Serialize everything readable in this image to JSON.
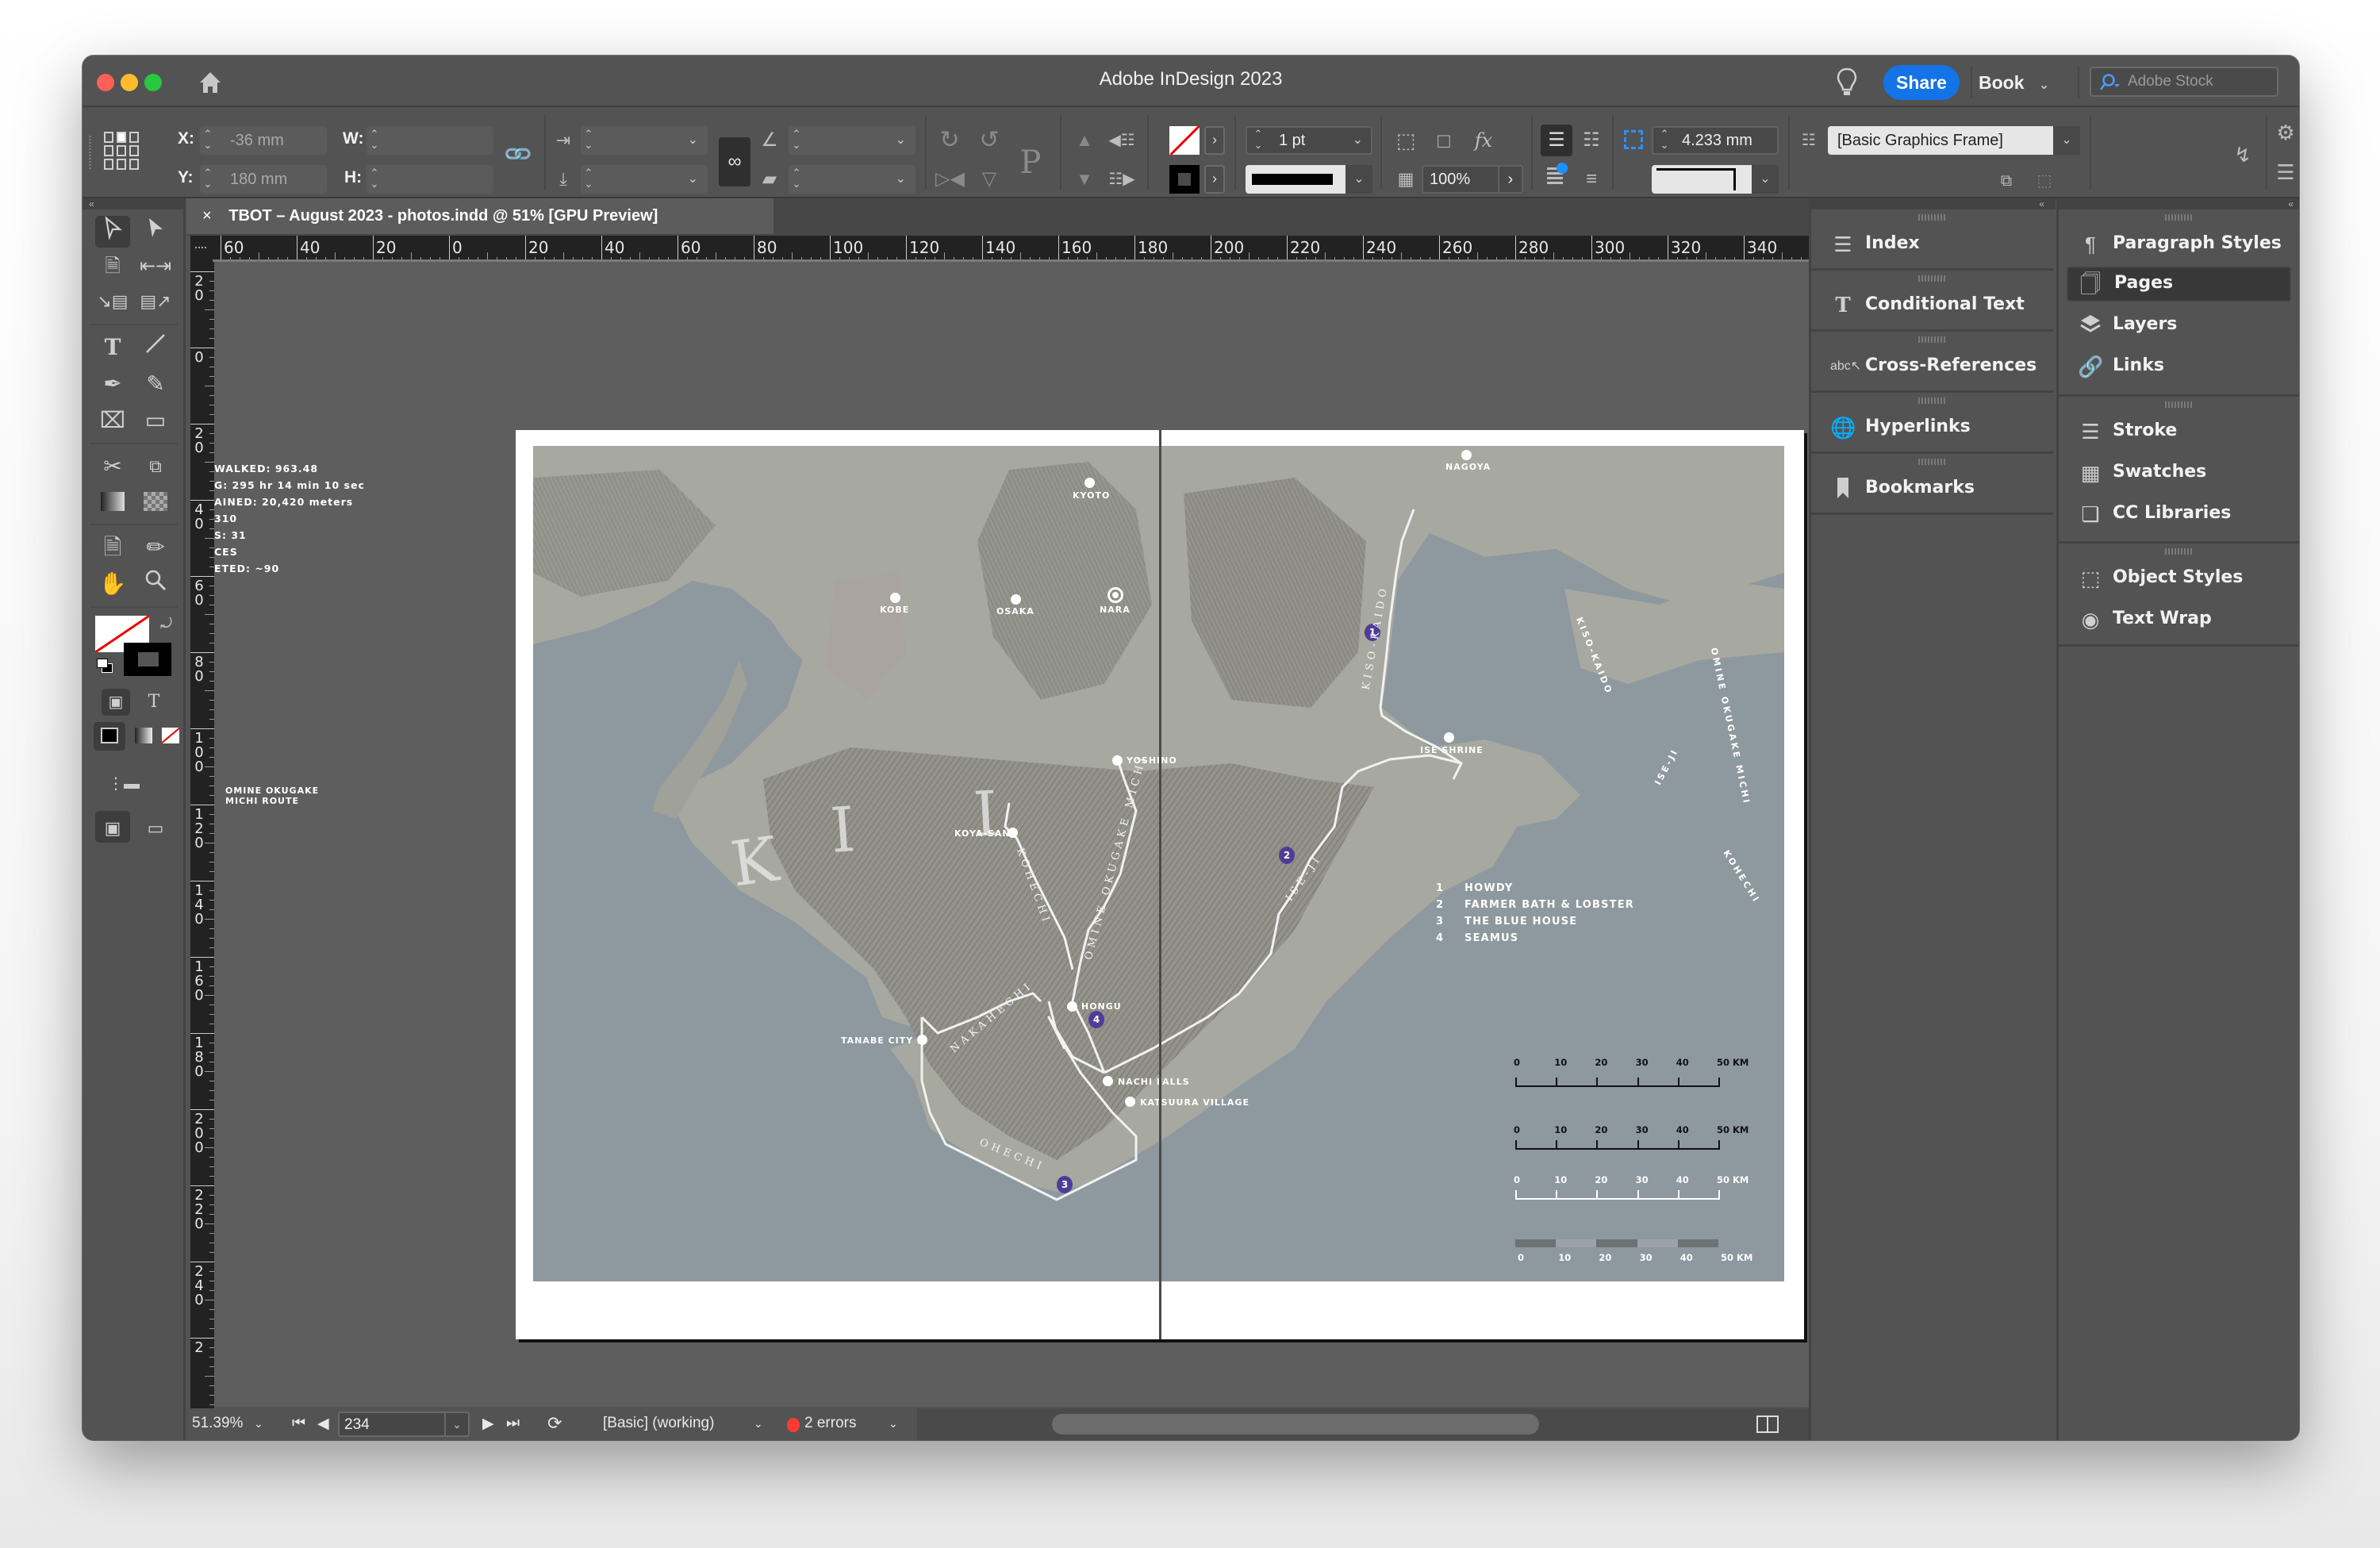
{
  "window": {
    "title": "Adobe InDesign 2023",
    "traffic_lights": {
      "close": "#ff5f57",
      "minimize": "#febc2e",
      "zoom": "#28c840"
    }
  },
  "header": {
    "share_label": "Share",
    "workspace_label": "Book",
    "stock_search_placeholder": "Adobe Stock",
    "accent_color": "#1473e6"
  },
  "control_bar": {
    "x_label": "X:",
    "x_value": "-36 mm",
    "y_label": "Y:",
    "y_value": "180 mm",
    "w_label": "W:",
    "w_value": "",
    "h_label": "H:",
    "h_value": "",
    "stroke_weight": "1 pt",
    "opacity": "100%",
    "frame_offset": "4.233 mm",
    "object_style": "[Basic Graphics Frame]"
  },
  "document": {
    "tab_title": "TBOT – August 2023 - photos.indd @ 51% [GPU Preview]",
    "close_glyph": "×"
  },
  "rulers": {
    "horizontal": [
      "60",
      "40",
      "20",
      "0",
      "20",
      "40",
      "60",
      "80",
      "100",
      "120",
      "140",
      "160",
      "180",
      "200",
      "220",
      "240",
      "260",
      "280",
      "300",
      "320",
      "340"
    ],
    "vertical": [
      "20",
      "0",
      "20",
      "40",
      "60",
      "80",
      "100",
      "120",
      "140",
      "160",
      "180",
      "200",
      "220",
      "240",
      "2"
    ]
  },
  "pasteboard": {
    "stats_lines": [
      "WALKED: 963.48",
      "G: 295 hr 14 min 10 sec",
      "AINED: 20,420 meters",
      "310",
      "S: 31",
      "CES",
      "ETED: ~90"
    ],
    "route_note": [
      "OMINE OKUGAKE",
      "MICHI ROUTE"
    ]
  },
  "map": {
    "cities": [
      {
        "name": "KYOTO"
      },
      {
        "name": "NAGOYA"
      },
      {
        "name": "KOBE"
      },
      {
        "name": "OSAKA"
      },
      {
        "name": "NARA"
      },
      {
        "name": "ISE SHRINE"
      },
      {
        "name": "YOSHINO"
      },
      {
        "name": "KOYA-SAN"
      },
      {
        "name": "HONGU"
      },
      {
        "name": "TANABE CITY"
      },
      {
        "name": "NACHI FALLS"
      },
      {
        "name": "KATSUURA VILLAGE"
      }
    ],
    "region_letters": [
      "K",
      "I",
      "I"
    ],
    "route_labels": {
      "kiso_kaido": "KISO-KAIDO",
      "omine": "OMINE OKUGAKE MICHI",
      "kohechi": "KOHECHI",
      "iseji": "ISE-JI",
      "nakahechi": "NAKAHECHI",
      "ohechi": "OHECHI"
    },
    "sample_labels": {
      "kiso_kaido": "KISO-KAIDO",
      "omine": "OMINE OKUGAKE MICHI",
      "iseji": "ISE-JI",
      "kohechi": "KOHECHI"
    },
    "markers": [
      "1",
      "2",
      "3",
      "4"
    ],
    "marker_color": "#4e3d96",
    "legend": [
      {
        "num": "1",
        "label": "HOWDY"
      },
      {
        "num": "2",
        "label": "FARMER BATH & LOBSTER"
      },
      {
        "num": "3",
        "label": "THE BLUE HOUSE"
      },
      {
        "num": "4",
        "label": "SEAMUS"
      }
    ],
    "scale_bars": [
      {
        "style": "black-ticks-above",
        "labels": [
          "0",
          "10",
          "20",
          "30",
          "40",
          "50 KM"
        ]
      },
      {
        "style": "black-ticks-compact",
        "labels": [
          "0",
          "10",
          "20",
          "30",
          "40",
          "50 KM"
        ]
      },
      {
        "style": "white-ticks",
        "labels": [
          "0",
          "10",
          "20",
          "30",
          "40",
          "50 KM"
        ]
      },
      {
        "style": "alternating-bar",
        "labels": [
          "0",
          "10",
          "20",
          "30",
          "40",
          "50 KM"
        ]
      }
    ]
  },
  "status_bar": {
    "zoom": "51.39%",
    "page": "234",
    "preflight_profile": "[Basic] (working)",
    "errors": "2 errors",
    "error_color": "#ff3b30"
  },
  "panels": {
    "left_column": [
      {
        "label": "Index",
        "icon": "index-icon"
      },
      {
        "label": "Conditional Text",
        "icon": "conditional-text-icon"
      },
      {
        "label": "Cross-References",
        "icon": "cross-references-icon"
      },
      {
        "label": "Hyperlinks",
        "icon": "hyperlinks-icon"
      },
      {
        "label": "Bookmarks",
        "icon": "bookmark-icon"
      }
    ],
    "right_column": [
      {
        "label": "Paragraph Styles",
        "icon": "paragraph-styles-icon"
      },
      {
        "label": "Pages",
        "icon": "pages-icon",
        "active": true
      },
      {
        "label": "Layers",
        "icon": "layers-icon"
      },
      {
        "label": "Links",
        "icon": "links-icon"
      },
      {
        "label": "Stroke",
        "icon": "stroke-icon"
      },
      {
        "label": "Swatches",
        "icon": "swatches-icon"
      },
      {
        "label": "CC Libraries",
        "icon": "cc-libraries-icon"
      },
      {
        "label": "Object Styles",
        "icon": "object-styles-icon"
      },
      {
        "label": "Text Wrap",
        "icon": "text-wrap-icon"
      }
    ]
  }
}
